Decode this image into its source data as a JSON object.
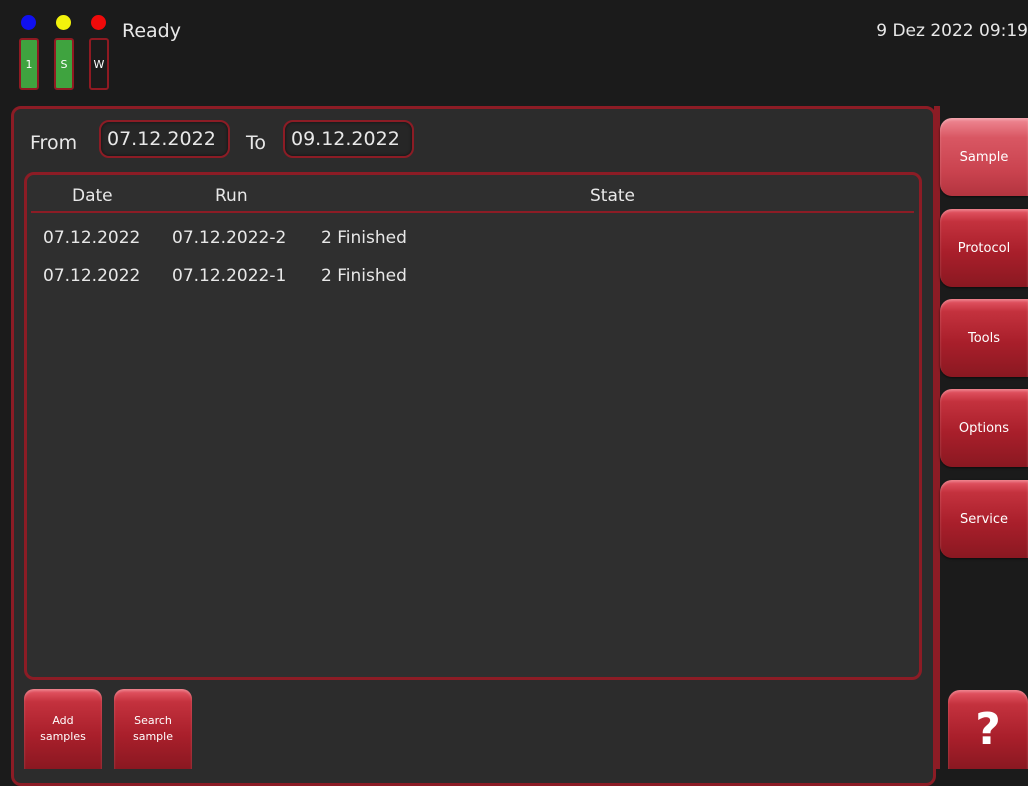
{
  "status": {
    "indicator_lights": [
      {
        "name": "blue",
        "color": "#1010f0"
      },
      {
        "name": "yellow",
        "color": "#f2f20c"
      },
      {
        "name": "red",
        "color": "#f00a0a"
      }
    ],
    "indicators": [
      {
        "label": "1",
        "state": "green"
      },
      {
        "label": "S",
        "state": "green"
      },
      {
        "label": "W",
        "state": "off"
      }
    ],
    "text": "Ready",
    "datetime": "9 Dez 2022  09:19"
  },
  "filter": {
    "from_label": "From",
    "from_value": "07.12.2022",
    "to_label": "To",
    "to_value": "09.12.2022"
  },
  "table": {
    "columns": [
      "Date",
      "Run",
      "State"
    ],
    "rows": [
      {
        "date": "07.12.2022",
        "run": "07.12.2022-2",
        "state": "2 Finished"
      },
      {
        "date": "07.12.2022",
        "run": "07.12.2022-1",
        "state": "2 Finished"
      }
    ]
  },
  "nav": {
    "items": [
      "Sample",
      "Protocol",
      "Tools",
      "Options",
      "Service"
    ],
    "active": "Sample",
    "help_label": "?"
  },
  "actions": {
    "add_samples": [
      "Add",
      "samples"
    ],
    "search_sample": [
      "Search",
      "sample"
    ]
  },
  "colors": {
    "accent": "#8c1c25",
    "button": "#a91f2b",
    "background": "#1b1b1b",
    "panel": "#2c2c2c"
  }
}
